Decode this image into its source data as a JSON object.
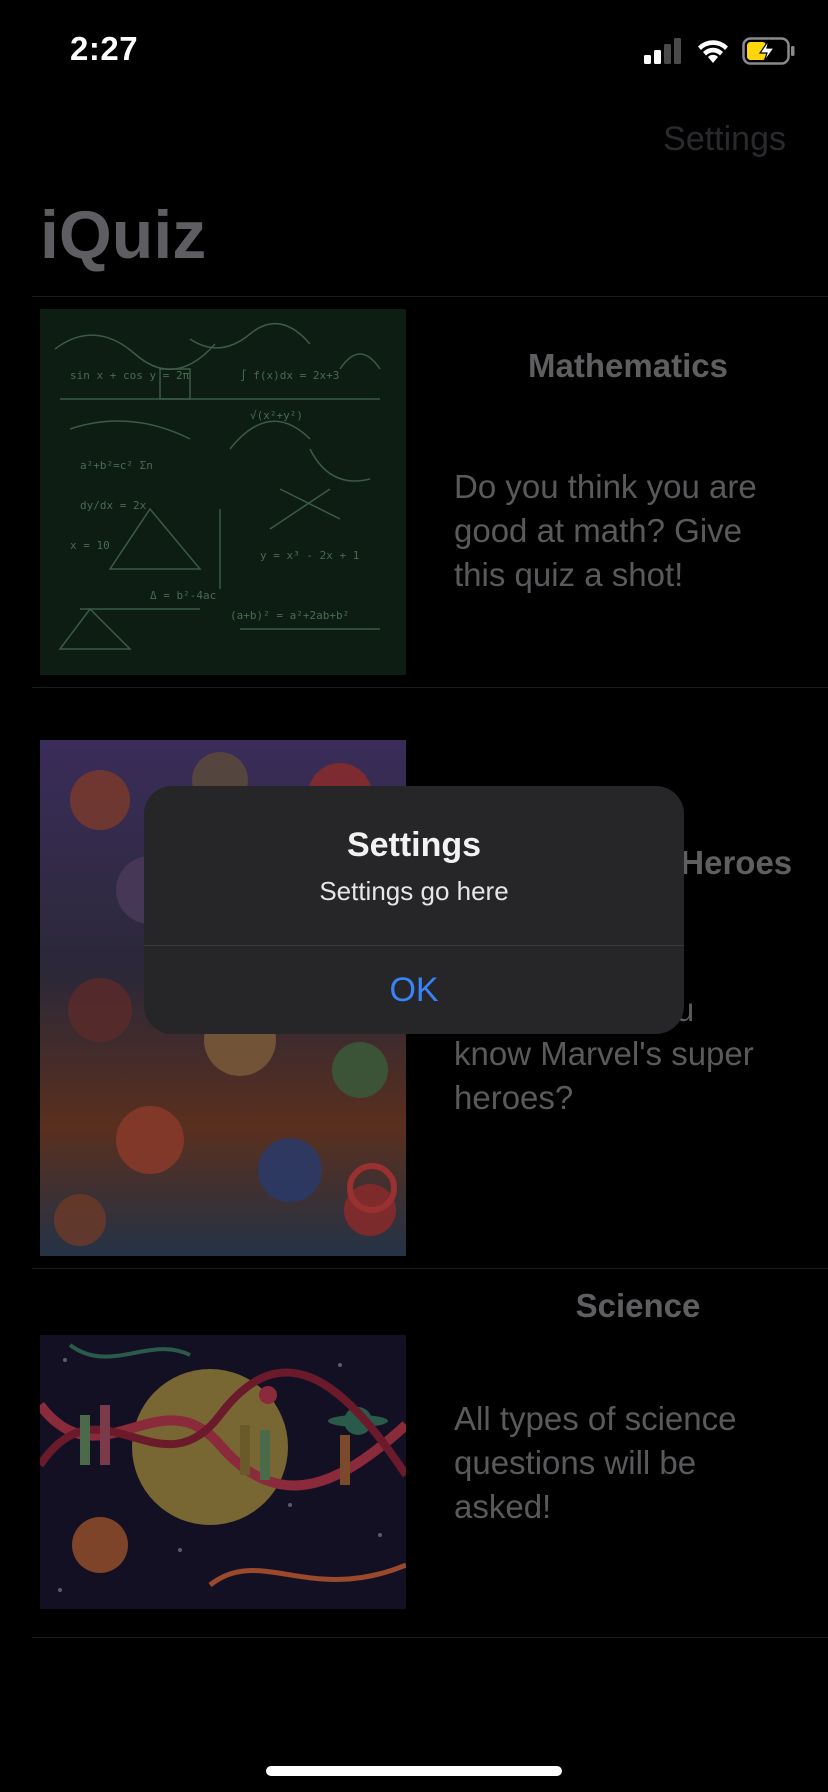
{
  "status_bar": {
    "time": "2:27"
  },
  "nav": {
    "settings_label": "Settings",
    "title": "iQuiz"
  },
  "quizzes": [
    {
      "title": "Mathematics",
      "description": "Do you think you are good at math? Give this quiz a shot!",
      "icon": "chalkboard-math-image"
    },
    {
      "title": "Marvel Super Heroes",
      "description": "How well do you know Marvel's super heroes?",
      "icon": "marvel-heroes-image"
    },
    {
      "title": "Science",
      "description": "All types of science questions will be asked!",
      "icon": "dna-science-image"
    }
  ],
  "alert": {
    "title": "Settings",
    "message": "Settings go here",
    "ok_label": "OK"
  },
  "colors": {
    "accent": "#3a82f7",
    "alert_bg": "#262628"
  }
}
